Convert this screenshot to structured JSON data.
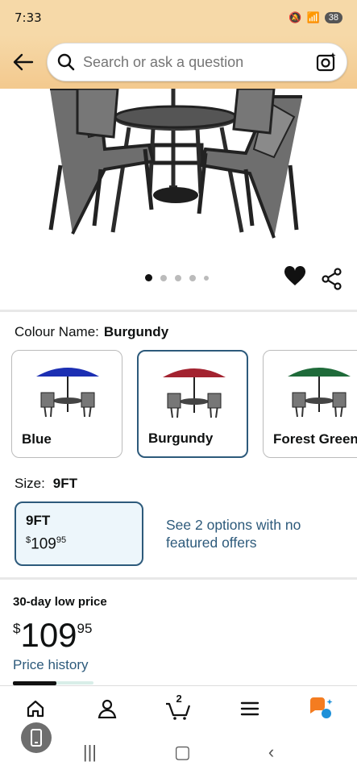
{
  "status_bar": {
    "time": "7:33",
    "battery": "38"
  },
  "header": {
    "search_placeholder": "Search or ask a question"
  },
  "gallery": {
    "image_count": 5,
    "active_index": 0
  },
  "colour": {
    "label": "Colour Name:",
    "selected": "Burgundy",
    "options": [
      {
        "label": "Blue",
        "color": "#1c2fb3"
      },
      {
        "label": "Burgundy",
        "color": "#a32330"
      },
      {
        "label": "Forest Green",
        "color": "#1f6b3a"
      }
    ]
  },
  "size": {
    "label": "Size:",
    "selected": "9FT",
    "option": {
      "name": "9FT",
      "price_symbol": "$",
      "price_whole": "109",
      "price_fraction": "95"
    },
    "see_options": "See 2 options with no featured offers"
  },
  "pricing": {
    "low_label": "30-day low price",
    "symbol": "$",
    "whole": "109",
    "fraction": "95",
    "history_link": "Price history"
  },
  "nav": {
    "cart_count": "2"
  },
  "colors": {
    "accent": "#2d5a7b",
    "header_bg": "#f6d9a8",
    "selected_bg": "#edf6fb"
  }
}
